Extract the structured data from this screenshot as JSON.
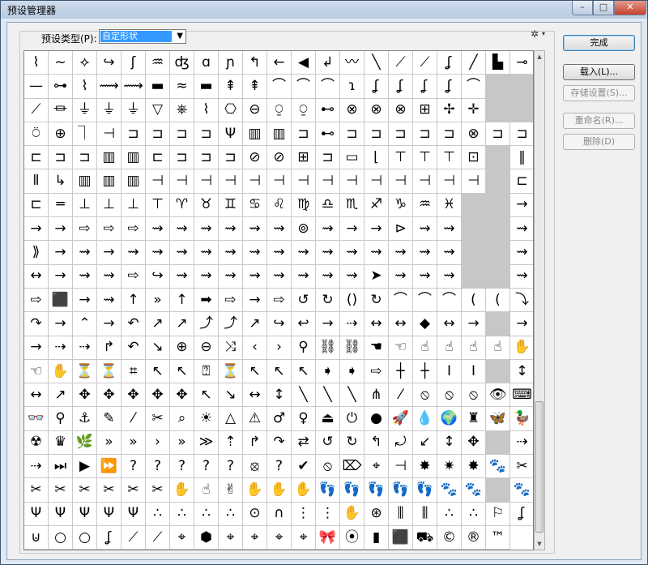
{
  "window": {
    "title": "预设管理器",
    "controls": [
      "–",
      "□",
      "✕"
    ]
  },
  "preset": {
    "label": "预设类型(P):",
    "selected": "自定形状"
  },
  "buttons": {
    "done": "完成",
    "load": "载入(L)...",
    "save": "存储设置(S)...",
    "rename": "重命名(R)...",
    "delete": "删除(D)"
  },
  "icons": {
    "settings": "gear-icon",
    "minimize": "minimize-icon",
    "maximize": "maximize-icon",
    "close": "close-icon",
    "scroll_up": "scroll-up-icon",
    "scroll_down": "scroll-down-icon"
  },
  "shapes": [
    "⌇",
    "~",
    "⟡",
    "↪",
    "ʃ",
    "♒",
    "ʤ",
    "ɑ",
    "ɲ",
    "↰",
    "←",
    "◀",
    "↲",
    "〰",
    "╲",
    "⟋",
    "⟋",
    "ʆ",
    "╱",
    "▙",
    "⊸",
    "—",
    "⊶",
    "⌇",
    "⟿",
    "⟿",
    "▬",
    "≈",
    "▬",
    "⇞",
    "⇞",
    "⌒",
    "⌒",
    "⌒",
    "ɿ",
    "ʆ",
    "ʆ",
    "ʆ",
    "ʆ",
    "⌒",
    "",
    "",
    "⟋",
    "⏛",
    "⏚",
    "⏚",
    "⏚",
    "▽",
    "⎈",
    "⌇",
    "⎔",
    "⊖",
    "⍜",
    "⍜",
    "⊷",
    "⊗",
    "⊗",
    "⊗",
    "⊞",
    "✢",
    "✛",
    "",
    "",
    "⍥",
    "⊕",
    "⏋",
    "⊣",
    "⊐",
    "⊐",
    "⊐",
    "⊐",
    "Ψ",
    "▥",
    "▥",
    "⊐",
    "⊷",
    "⊐",
    "⊐",
    "⊐",
    "⊐",
    "⊐",
    "⊗",
    "⊐",
    "⊐",
    "⊏",
    "⊐",
    "⊐",
    "▥",
    "▥",
    "⊏",
    "⊐",
    "⊐",
    "⊐",
    "⊘",
    "⊘",
    "⊞",
    "⊐",
    "▭",
    "⌊",
    "⊤",
    "⊤",
    "⊤",
    "⊡",
    "",
    "‖",
    "⫴",
    "↳",
    "▥",
    "▥",
    "▥",
    "⊣",
    "⊣",
    "⊣",
    "⊣",
    "⊣",
    "⊣",
    "⊣",
    "⊣",
    "⊣",
    "⊣",
    "⊣",
    "⊣",
    "⊣",
    "⊣",
    "",
    "⊏",
    "⊏",
    "═",
    "⊥",
    "⊥",
    "⊥",
    "⊤",
    "♈",
    "♉",
    "♊",
    "♋",
    "♌",
    "♍",
    "♎",
    "♏",
    "♐",
    "♑",
    "♒",
    "♓",
    "",
    "",
    "→",
    "→",
    "→",
    "⇨",
    "⇨",
    "⇨",
    "⇝",
    "⇝",
    "⇝",
    "⇝",
    "⇝",
    "⇝",
    "⊚",
    "⇝",
    "→",
    "→",
    "⊳",
    "⇝",
    "⇝",
    "",
    "",
    "⇝",
    "⟫",
    "→",
    "⇝",
    "→",
    "⇝",
    "⇝",
    "⇝",
    "⇝",
    "⇝",
    "⇝",
    "⇝",
    "⇝",
    "⇝",
    "⇝",
    "⇝",
    "⇝",
    "⇝",
    "⇝",
    "",
    "",
    "⇝",
    "↔",
    "→",
    "⇝",
    "⇝",
    "⇨",
    "↪",
    "⇝",
    "⇝",
    "⇝",
    "⇝",
    "⇝",
    "⇝",
    "⇝",
    "⇝",
    "➤",
    "⇝",
    "⇝",
    "⇝",
    "",
    "",
    "⇝",
    "⇨",
    "⬛",
    "→",
    "⇝",
    "↑",
    "»",
    "↑",
    "➡",
    "⇨",
    "→",
    "⇨",
    "↺",
    "↻",
    "()",
    "↻",
    "⌒",
    "⌒",
    "⌒",
    "(",
    "(",
    "⤵",
    "↷",
    "→",
    "⌃",
    "→",
    "↶",
    "↗",
    "↗",
    "⤴",
    "⤴",
    "↗",
    "↪",
    "↩",
    "→",
    "⇢",
    "↔",
    "↔",
    "◆",
    "↔",
    "→",
    "",
    "→",
    "→",
    "⇢",
    "⇢",
    "↱",
    "↶",
    "↘",
    "⊕",
    "⊖",
    "⤨",
    "‹",
    "›",
    "⚲",
    "⛓",
    "⛓",
    "☚",
    "☜",
    "☝",
    "☝",
    "☝",
    "☝",
    "✋",
    "☜",
    "✋",
    "⏳",
    "⏳",
    "⌗",
    "↖",
    "↖",
    "⍰",
    "⏳",
    "↖",
    "↖",
    "↖",
    "➧",
    "➧",
    "⇨",
    "┼",
    "┼",
    "Ⅰ",
    "Ⅰ",
    "",
    "↕",
    "↔",
    "↗",
    "✥",
    "✥",
    "✥",
    "✥",
    "✥",
    "↖",
    "↘",
    "↔",
    "↕",
    "╲",
    "╲",
    "╲",
    "⋔",
    "⁄",
    "⦸",
    "⦸",
    "⦸",
    "👁",
    "⌨",
    "👓",
    "⚲",
    "⚓",
    "✎",
    "⁄",
    "✂",
    "⌕",
    "☀",
    "△",
    "⚠",
    "♂",
    "♀",
    "⏏",
    "⏻",
    "●",
    "🚀",
    "💧",
    "🌍",
    "♜",
    "🦋",
    "🦆",
    "☢",
    "♛",
    "🌿",
    "»",
    "»",
    "›",
    "»",
    "≫",
    "⇡",
    "↱",
    "↷",
    "⇄",
    "↺",
    "↻",
    "↰",
    "⤾",
    "↙",
    "↕",
    "✥",
    "",
    "⇢",
    "⇢",
    "⏭",
    "▶",
    "⏩",
    "?",
    "?",
    "?",
    "?",
    "?",
    "⦻",
    "?",
    "✔",
    "⦸",
    "⌦",
    "⌖",
    "⊣",
    "✸",
    "✷",
    "✸",
    "🐾",
    "✂",
    "✂",
    "✂",
    "✂",
    "✂",
    "✂",
    "✂",
    "✋",
    "☝",
    "✌",
    "✋",
    "✋",
    "✋",
    "👣",
    "👣",
    "👣",
    "👣",
    "👣",
    "🐾",
    "🐾",
    "",
    "🐾",
    "Ψ",
    "Ψ",
    "Ψ",
    "Ψ",
    "Ψ",
    "∴",
    "∴",
    "∴",
    "∴",
    "⊙",
    "∩",
    "⋮",
    "⋮",
    "✋",
    "⊛",
    "⫼",
    "⫼",
    "∴",
    "∴",
    "⚐",
    "ʆ",
    "⊍",
    "○",
    "○",
    "ʆ",
    "⟋",
    "⟋",
    "⌖",
    "⬢",
    "⌖",
    "⌖",
    "⌖",
    "⌖",
    "🎀",
    "⦿",
    "▮",
    "⬛",
    "⛟",
    "©",
    "®",
    "™"
  ]
}
